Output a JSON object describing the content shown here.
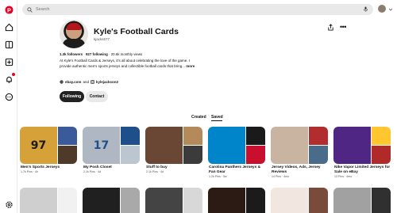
{
  "search": {
    "placeholder": "Search"
  },
  "profile": {
    "name": "Kyle's Football Cards",
    "handle": "kjacks577",
    "followers": "1.3k followers",
    "following": "927 following",
    "monthly_views": "20.6k monthly views",
    "bio": "At Kyle's Football Cards & Jerseys, it's all about celebrating the love of the game. I provide authentic men's sports jerseys and collectible football cards that bring...",
    "bio_more": "more",
    "website": "ebay.com",
    "and_text": "and",
    "instagram": "kylejackson2"
  },
  "buttons": {
    "following": "Following",
    "contact": "Contact"
  },
  "tabs": {
    "created": "Created",
    "saved": "Saved"
  },
  "boards": [
    {
      "title": "Men's Sports Jerseys",
      "meta": "1.7k Pins · 4h",
      "colors": [
        "#d7a13a",
        "#3a5a9a",
        "#4f3a2a"
      ],
      "number": "97"
    },
    {
      "title": "My Posh Closet",
      "meta": "2.1k Pins · 4d",
      "colors": [
        "#aeb7c2",
        "#1e4f8a",
        "#bcc6d0"
      ],
      "number": "17"
    },
    {
      "title": "Stuff to buy",
      "meta": "2.1k Pins · 4d",
      "colors": [
        "#6a4634",
        "#b58a5a",
        "#3b3b3b"
      ],
      "number": ""
    },
    {
      "title": "Carolina Panthers Jerseys & Fan Gear",
      "meta": "1.2k Pins · 5w",
      "colors": [
        "#0085ca",
        "#1a1a1a",
        "#c8102e"
      ],
      "number": ""
    },
    {
      "title": "Jersey Videos, Ads, Jersey Reviews",
      "meta": "14 Pins · 4mo",
      "colors": [
        "#c8b4a0",
        "#b22d2d",
        "#4a6b8a"
      ],
      "number": ""
    },
    {
      "title": "Nike Vapor Limited Jerseys for Sale on eBay",
      "meta": "13 Pins · 4mo",
      "colors": [
        "#4f2683",
        "#ffc62f",
        "#b02a2a"
      ],
      "number": ""
    }
  ],
  "row2_colors": [
    [
      "#cfcfcf",
      "#f1f1f1"
    ],
    [
      "#202020",
      "#a9a9a9"
    ],
    [
      "#444444",
      "#d8d8d8"
    ],
    [
      "#2b1b14",
      "#1b1b1b"
    ],
    [
      "#f2e6e0",
      "#7a4b3a"
    ],
    [
      "#a1a1a1",
      "#303030"
    ]
  ],
  "icons": [
    "pinterest-logo-icon",
    "home-icon",
    "boards-icon",
    "create-icon",
    "notifications-icon",
    "messages-icon",
    "settings-icon",
    "search-icon",
    "mic-icon",
    "share-icon",
    "more-icon"
  ]
}
